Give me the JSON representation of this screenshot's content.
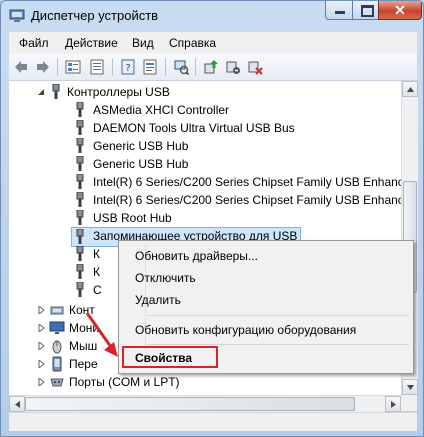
{
  "window": {
    "title": "Диспетчер устройств",
    "close_glyph": "✕"
  },
  "menu": {
    "file": "Файл",
    "action": "Действие",
    "view": "Вид",
    "help": "Справка"
  },
  "tree": {
    "root": "Контроллеры USB",
    "children": [
      "ASMedia XHCI Controller",
      "DAEMON Tools Ultra Virtual USB Bus",
      "Generic USB Hub",
      "Generic USB Hub",
      "Intel(R) 6 Series/C200 Series Chipset Family USB Enhanced H",
      "Intel(R) 6 Series/C200 Series Chipset Family USB Enhanced H",
      "USB Root Hub",
      "Запоминающее устройство для USB",
      "К",
      "К",
      "С"
    ],
    "categories": [
      "Конт",
      "Мони",
      "Мыш",
      "Пере",
      "Порты (COM и LPT)"
    ]
  },
  "context_menu": {
    "update_drivers": "Обновить драйверы...",
    "disable": "Отключить",
    "remove": "Удалить",
    "scan": "Обновить конфигурацию оборудования",
    "properties": "Свойства"
  },
  "colors": {
    "highlight_red": "#d9232a",
    "selection": "#cde6fb"
  }
}
